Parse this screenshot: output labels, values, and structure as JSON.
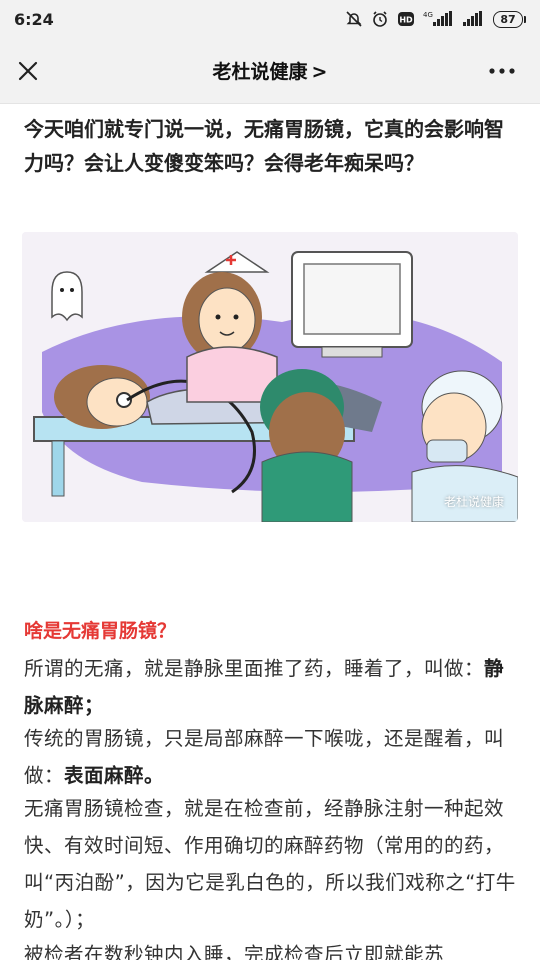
{
  "status_bar": {
    "time": "6:24",
    "network": "4G",
    "hd": "HD",
    "battery": "87"
  },
  "nav": {
    "title": "老杜说健康",
    "title_chevron": ">",
    "close_icon": "close-icon",
    "more_icon": "more-icon"
  },
  "article": {
    "headline": "今天咱们就专门说一说，无痛胃肠镜，它真的会影响智力吗？会让人变傻变笨吗？会得老年痴呆吗？",
    "illustration_watermark": "老杜说健康",
    "section_title": "啥是无痛胃肠镜？",
    "p1_text": "所谓的无痛，就是静脉里面推了药，睡着了，叫做：",
    "p1_bold": "静脉麻醉；",
    "p2_text": "传统的胃肠镜，只是局部麻醉一下喉咙，还是醒着，叫做：",
    "p2_bold": "表面麻醉。",
    "p3": "无痛胃肠镜检查，就是在检查前，经静脉注射一种起效快、有效时间短、作用确切的麻醉药物（常用的的药，叫“丙泊酚”，因为它是乳白色的，所以我们戏称之“打牛奶”。）；",
    "p4": "被检者在数秒钟内入睡，完成检查后立即就能苏"
  },
  "colors": {
    "section_title": "#e53935",
    "bar_bg": "#f2f2f2",
    "illustration_purple": "#8a6fd6"
  }
}
